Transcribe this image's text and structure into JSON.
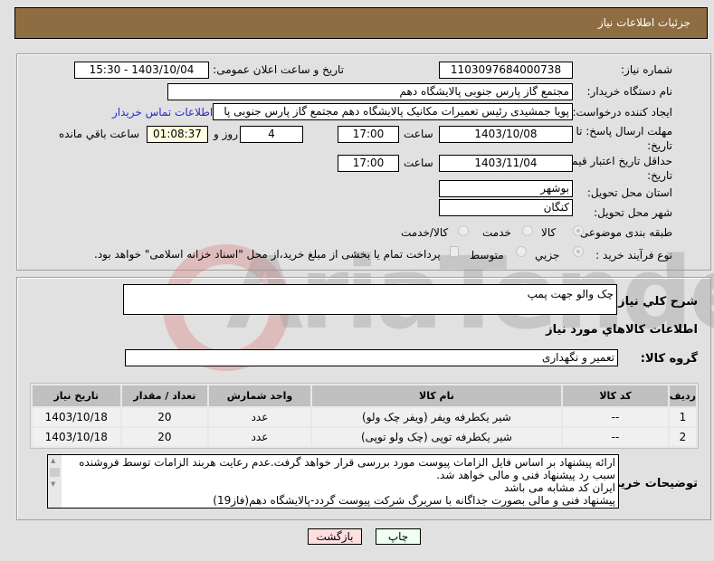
{
  "header": {
    "title": "جزئیات اطلاعات نیاز"
  },
  "details": {
    "need_number_label": "شماره نیاز:",
    "need_number": "1103097684000738",
    "announce_label": "تاریخ و ساعت اعلان عمومی:",
    "announce_value": "1403/10/04 - 15:30",
    "buyer_org_label": "نام دستگاه خریدار:",
    "buyer_org": "مجتمع گاز پارس جنوبی  پالایشگاه دهم",
    "creator_label": "ایجاد کننده درخواست:",
    "creator": "پویا جمشیدی رئیس تعمیرات مکانیک پالایشگاه دهم  مجتمع گاز پارس جنوبی  پا",
    "contact_link": "اطلاعات تماس خریدار",
    "deadline_label": "مهلت ارسال پاسخ: تا تاریخ:",
    "deadline_date": "1403/10/08",
    "time_label": "ساعت",
    "deadline_time": "17:00",
    "days_value": "4",
    "days_label": "روز و",
    "remaining_time": "01:08:37",
    "remaining_label": "ساعت باقي مانده",
    "validity_label": "حداقل تاریخ اعتبار قیمت: تا تاریخ:",
    "validity_date": "1403/11/04",
    "validity_time": "17:00",
    "province_label": "استان محل تحویل:",
    "province": "بوشهر",
    "city_label": "شهر محل تحویل:",
    "city": "کنگان",
    "category_label": "طبقه بندی موضوعی:",
    "category_options": [
      "کالا",
      "خدمت",
      "کالا/خدمت"
    ],
    "category_selected": "کالا",
    "process_label": "نوع فرآیند خرید :",
    "process_options": [
      "جزیي",
      "متوسط"
    ],
    "process_selected": "جزیي",
    "payment_note": "پرداخت تمام یا بخشی از مبلغ خرید،از محل \"اسناد خزانه اسلامی\" خواهد بود."
  },
  "description": {
    "label": "شرح کلي نياز:",
    "value": "چک والو جهت پمپ",
    "goods_info_title": "اطلاعات کالاهاي مورد نياز",
    "group_label": "گروه کالا:",
    "group_value": "تعمیر و نگهداری"
  },
  "items_table": {
    "columns": [
      "ردیف",
      "کد کالا",
      "نام کالا",
      "واحد شمارش",
      "تعداد / مقدار",
      "تاریخ نیاز"
    ],
    "rows": [
      [
        "1",
        "--",
        "شیر یکطرفه ویفر (ویفر چک ولو)",
        "عدد",
        "20",
        "1403/10/18"
      ],
      [
        "2",
        "--",
        "شیر یکطرفه توپی (چک ولو توپی)",
        "عدد",
        "20",
        "1403/10/18"
      ]
    ]
  },
  "buyer_notes": {
    "label": "توضیحات خریدار:",
    "lines": [
      "ارائه پیشنهاد بر اساس فایل الزامات پیوست مورد بررسی قرار خواهد گرفت.عدم رعایت هربند الزامات توسط فروشنده",
      "سبب رد پیشنهاد فنی و مالی خواهد شد.",
      "ایران کد مشابه می باشد",
      "پیشنهاد فنی و مالی بصورت جداگانه با سربرگ شرکت پیوست گردد-پالایشگاه دهم(فاز19)"
    ]
  },
  "buttons": {
    "print": "چاپ",
    "back": "بازگشت"
  },
  "watermark": "AriaTender.neT"
}
